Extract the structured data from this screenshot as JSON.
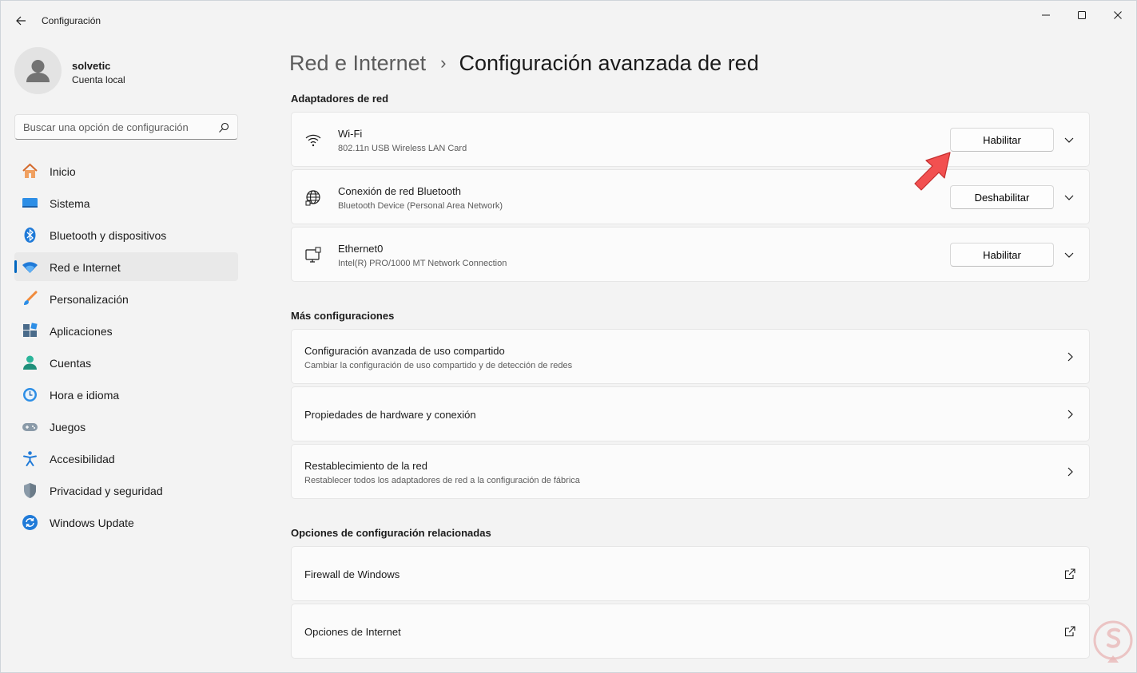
{
  "window": {
    "title": "Configuración"
  },
  "profile": {
    "name": "solvetic",
    "account_type": "Cuenta local"
  },
  "search": {
    "placeholder": "Buscar una opción de configuración"
  },
  "sidebar": {
    "items": [
      {
        "label": "Inicio",
        "icon": "home-icon"
      },
      {
        "label": "Sistema",
        "icon": "system-icon"
      },
      {
        "label": "Bluetooth y dispositivos",
        "icon": "bluetooth-icon"
      },
      {
        "label": "Red e Internet",
        "icon": "network-icon",
        "active": true
      },
      {
        "label": "Personalización",
        "icon": "brush-icon"
      },
      {
        "label": "Aplicaciones",
        "icon": "apps-icon"
      },
      {
        "label": "Cuentas",
        "icon": "accounts-icon"
      },
      {
        "label": "Hora e idioma",
        "icon": "time-language-icon"
      },
      {
        "label": "Juegos",
        "icon": "gamepad-icon"
      },
      {
        "label": "Accesibilidad",
        "icon": "accessibility-icon"
      },
      {
        "label": "Privacidad y seguridad",
        "icon": "shield-icon"
      },
      {
        "label": "Windows Update",
        "icon": "update-icon"
      }
    ]
  },
  "breadcrumb": {
    "parent": "Red e Internet",
    "separator": "›",
    "current": "Configuración avanzada de red"
  },
  "adapters": {
    "title": "Adaptadores de red",
    "items": [
      {
        "name": "Wi-Fi",
        "description": "802.11n USB Wireless LAN Card",
        "button": "Habilitar",
        "icon": "wifi-icon"
      },
      {
        "name": "Conexión de red Bluetooth",
        "description": "Bluetooth Device (Personal Area Network)",
        "button": "Deshabilitar",
        "icon": "globe-icon"
      },
      {
        "name": "Ethernet0",
        "description": "Intel(R) PRO/1000 MT Network Connection",
        "button": "Habilitar",
        "icon": "ethernet-icon"
      }
    ]
  },
  "more_settings": {
    "title": "Más configuraciones",
    "items": [
      {
        "name": "Configuración avanzada de uso compartido",
        "description": "Cambiar la configuración de uso compartido y de detección de redes"
      },
      {
        "name": "Propiedades de hardware y conexión",
        "description": ""
      },
      {
        "name": "Restablecimiento de la red",
        "description": "Restablecer todos los adaptadores de red a la configuración de fábrica"
      }
    ]
  },
  "related": {
    "title": "Opciones de configuración relacionadas",
    "items": [
      {
        "name": "Firewall de Windows"
      },
      {
        "name": "Opciones de Internet"
      }
    ]
  },
  "colors": {
    "accent": "#0067c0",
    "pointer_arrow": "#f25050",
    "window_bg": "#f3f3f3",
    "card_bg": "#fbfbfb"
  }
}
